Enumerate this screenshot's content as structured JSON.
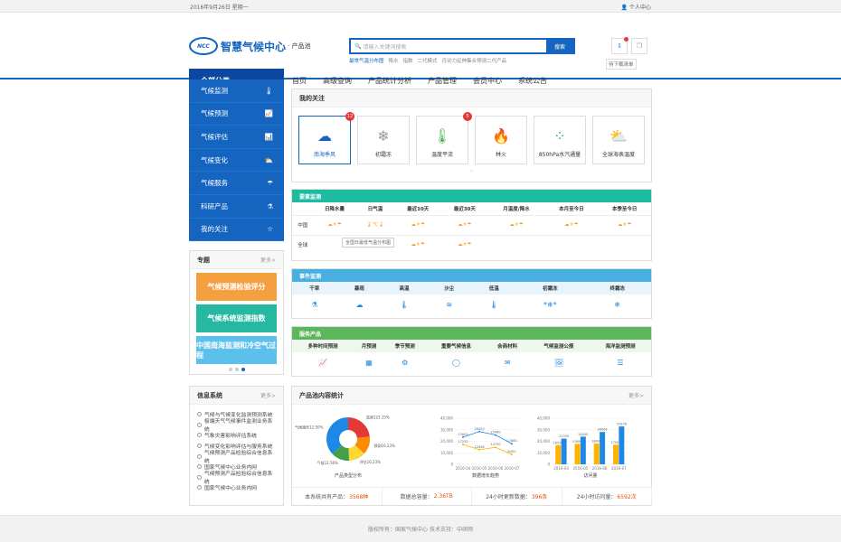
{
  "topbar": {
    "date": "2016年9月26日 星期一",
    "user": "个人中心"
  },
  "logo": {
    "emblem": "NCC",
    "name": "智慧气候中心",
    "sub": "· 产品池"
  },
  "search": {
    "placeholder": "请输入关键词搜索",
    "button": "搜索",
    "hot": [
      "最常气温分布图",
      "降水",
      "指数",
      "二代模式",
      "月动力延伸集合预测二代产品"
    ]
  },
  "header": {
    "download_tip": "待下载清单"
  },
  "nav": {
    "all": "全部分类",
    "items": [
      "首页",
      "高级查询",
      "产品统计分析",
      "产品管理",
      "会员中心",
      "系统公告"
    ]
  },
  "leftmenu": [
    {
      "label": "气候监测",
      "icon": "🌡"
    },
    {
      "label": "气候预测",
      "icon": "📈"
    },
    {
      "label": "气候评估",
      "icon": "📊"
    },
    {
      "label": "气候变化",
      "icon": "⛅"
    },
    {
      "label": "气候服务",
      "icon": "☂"
    },
    {
      "label": "科研产品",
      "icon": "⚗"
    },
    {
      "label": "我的关注",
      "icon": "☆"
    }
  ],
  "topics": {
    "title": "专题",
    "more": "更多>",
    "items": [
      {
        "label": "气候预测检验评分",
        "color": "#f5a040"
      },
      {
        "label": "气候系统监测指数",
        "color": "#26b8a0"
      },
      {
        "label": "中国南海监测和冷空气过程",
        "color": "#5cc0ec"
      }
    ]
  },
  "info": {
    "title": "信息系统",
    "more": "更多>",
    "items": [
      "气候与气候变化监测预测系统",
      "极端天气气候事件监测业务系统",
      "气象灾害影响评估系统",
      "气候变化影响评估与服务系统",
      "气候预测产品检验综合信息系统",
      "国家气候中心业务内网",
      "气候预测产品检验综合信息系统",
      "国家气候中心业务内网"
    ]
  },
  "favorites": {
    "title": "我的关注",
    "items": [
      {
        "label": "南海季风",
        "icon": "☁",
        "badge": "12",
        "color": "#1565c0"
      },
      {
        "label": "初霜冻",
        "icon": "❄",
        "badge": "",
        "color": "#999"
      },
      {
        "label": "温度平流",
        "icon": "🌡",
        "badge": "5",
        "color": "#4caf50"
      },
      {
        "label": "林火",
        "icon": "🔥",
        "badge": "",
        "color": "#ff9800"
      },
      {
        "label": "850hPa水汽通量",
        "icon": "⁘",
        "badge": "",
        "color": "#26a69a"
      },
      {
        "label": "全球海表温度",
        "icon": "⛅",
        "badge": "",
        "color": "#ffb300"
      }
    ]
  },
  "elements": {
    "title": "要素监测",
    "color": "#1dbba0",
    "cols": [
      "日降水量",
      "日气温",
      "最近10天",
      "最近30天",
      "月温度/降水",
      "本月至今日",
      "本季至今日"
    ],
    "rows": [
      {
        "name": "中国",
        "cells": [
          "☁☀☂",
          "🌡℃🌡",
          "☁☀☂",
          "☁☀☂",
          "☁☀☂",
          "☁☀☂",
          "☁☀☂"
        ]
      },
      {
        "name": "全球",
        "cells": [
          "",
          "",
          "☁☀☂",
          "☁☀☂",
          "",
          "",
          ""
        ]
      }
    ],
    "tooltip": "全国日最低气温分布图"
  },
  "events": {
    "title": "事件监测",
    "color": "#49aee0",
    "cols": [
      "干旱",
      "暴雨",
      "高温",
      "沙尘",
      "低温",
      "初霜冻",
      "终霜冻"
    ],
    "icons": [
      "⚗",
      "☁",
      "🌡",
      "≋",
      "🌡",
      "*❄*",
      "❄"
    ]
  },
  "services": {
    "title": "服务产品",
    "color": "#5db55c",
    "cols": [
      "多种时间预测",
      "月预测",
      "季节预测",
      "重要气候信息",
      "会商材料",
      "气候监测公报",
      "海洋监测预测"
    ],
    "icons": [
      "📈",
      "▦",
      "⚙",
      "◯",
      "✉",
      "🖼",
      "☰"
    ]
  },
  "stats": {
    "title": "产品池内容统计",
    "more": "更多>",
    "labels": [
      "产品类型分布",
      "数据增长趋势",
      "访问量"
    ],
    "bottom": [
      {
        "label": "本系统共有产品：",
        "value": "3568种"
      },
      {
        "label": "数据总容量：",
        "value": "2.36TB"
      },
      {
        "label": "24小时更新数据：",
        "value": "396条"
      },
      {
        "label": "24小时访问量：",
        "value": "6592次"
      }
    ]
  },
  "chart_data": [
    {
      "type": "pie",
      "categories": [
        "气候监测",
        "气候预测",
        "气候评估",
        "气候变化",
        "气候服务"
      ],
      "values": [
        23.15,
        13.65,
        12.5,
        13.5,
        37.2
      ],
      "labels": [
        "监测123.15%",
        "预测16.23%",
        "评估16.23%",
        "气候12.56%",
        "气候服务12.50%"
      ],
      "colors": [
        "#e53935",
        "#fb8c00",
        "#fdd835",
        "#43a047",
        "#1e88e5"
      ]
    },
    {
      "type": "line",
      "x": [
        "2016-04",
        "2016-05",
        "2016-06",
        "2016-07"
      ],
      "ylim": [
        0,
        40000
      ],
      "yticks": [
        "0",
        "10,000",
        "20,000",
        "30,000",
        "40,000"
      ],
      "series": [
        {
          "values": [
            23605,
            28420,
            25460,
            17865
          ],
          "color": "#1e88e5"
        },
        {
          "values": [
            17232,
            12648,
            14750,
            8450
          ],
          "color": "#ffb300"
        }
      ]
    },
    {
      "type": "bar",
      "x": [
        "2016-04",
        "2016-05",
        "2016-06",
        "2016-07"
      ],
      "ylim": [
        0,
        40000
      ],
      "yticks": [
        "0",
        "10,000",
        "20,000",
        "30,000",
        "40,000"
      ],
      "series": [
        {
          "values": [
            16533,
            17800,
            18000,
            17002
          ],
          "color": "#ffb300"
        },
        {
          "values": [
            22335,
            24000,
            28064,
            32878
          ],
          "color": "#1e88e5"
        }
      ]
    }
  ],
  "footer": "版权所有：国家气候中心   技术支持：中研网"
}
